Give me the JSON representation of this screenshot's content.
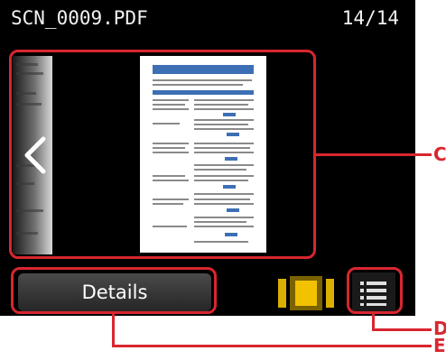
{
  "header": {
    "filename": "SCN_0009.PDF",
    "page_counter": "14/14"
  },
  "preview": {
    "prev_icon": "chevron-left-icon"
  },
  "toolbar": {
    "details_label": "Details",
    "single_view_icon": "single-page-view-icon",
    "list_view_icon": "list-view-icon"
  },
  "callouts": {
    "c": "C",
    "d": "D",
    "e": "E"
  },
  "colors": {
    "screen_bg": "#000000",
    "highlight": "#d9262f",
    "active_view": "#f2c200"
  }
}
